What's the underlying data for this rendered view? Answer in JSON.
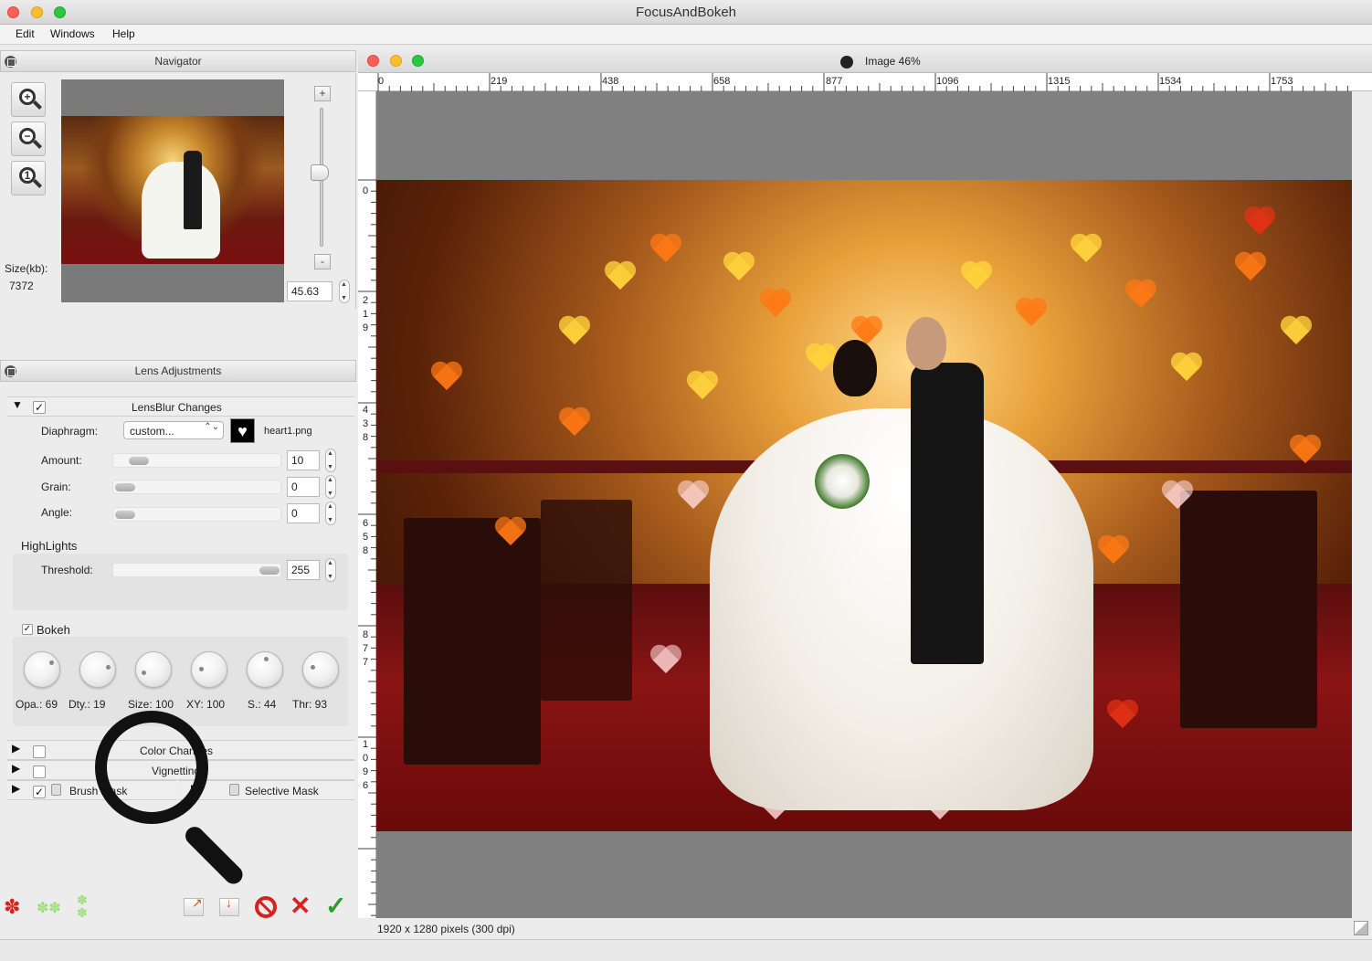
{
  "app": {
    "title": "FocusAndBokeh"
  },
  "menu": {
    "items": [
      "Edit",
      "Windows",
      "Help"
    ]
  },
  "navigator": {
    "title": "Navigator",
    "size_label": "Size(kb):",
    "size_value": "7372",
    "zoom_value": "45.63",
    "zoom_plus": "+",
    "zoom_minus": "-"
  },
  "lens": {
    "title": "Lens Adjustments",
    "lensblur_label": "LensBlur Changes",
    "diaphragm_label": "Diaphragm:",
    "diaphragm_value": "custom...",
    "diaphragm_file": "heart1.png",
    "amount_label": "Amount:",
    "amount_value": "10",
    "grain_label": "Grain:",
    "grain_value": "0",
    "angle_label": "Angle:",
    "angle_value": "0",
    "highlights_label": "HighLights",
    "threshold_label": "Threshold:",
    "threshold_value": "255",
    "bokeh_label": "Bokeh",
    "knobs": [
      "Opa.: 69",
      "Dty.: 19",
      "Size: 100",
      "XY: 100",
      "S.: 44",
      "Thr: 93"
    ],
    "color_changes_label": "Color Changes",
    "vignetting_label": "Vignetting",
    "brush_mask_label": "Brush Mask",
    "selective_mask_label": "Selective Mask"
  },
  "image_window": {
    "title": "Image 46%",
    "ruler_h": [
      "0",
      "219",
      "438",
      "658",
      "877",
      "1096",
      "1315",
      "1534",
      "1753"
    ],
    "ruler_v": [
      "0",
      "2\n1\n9",
      "4\n3\n8",
      "6\n5\n8",
      "8\n7\n7",
      "1\n0\n9\n6"
    ],
    "status": "1920 x 1280 pixels (300 dpi)"
  },
  "colors": {
    "accent_red": "#d82222",
    "accent_green": "#2aa02a",
    "canvas_gray": "#808080"
  },
  "icons": [
    "zoom-in-icon",
    "zoom-out-icon",
    "zoom-actual-icon",
    "magnifier-icon",
    "flower-icon",
    "export-icon",
    "import-icon",
    "reset-icon",
    "cancel-icon",
    "apply-icon"
  ]
}
